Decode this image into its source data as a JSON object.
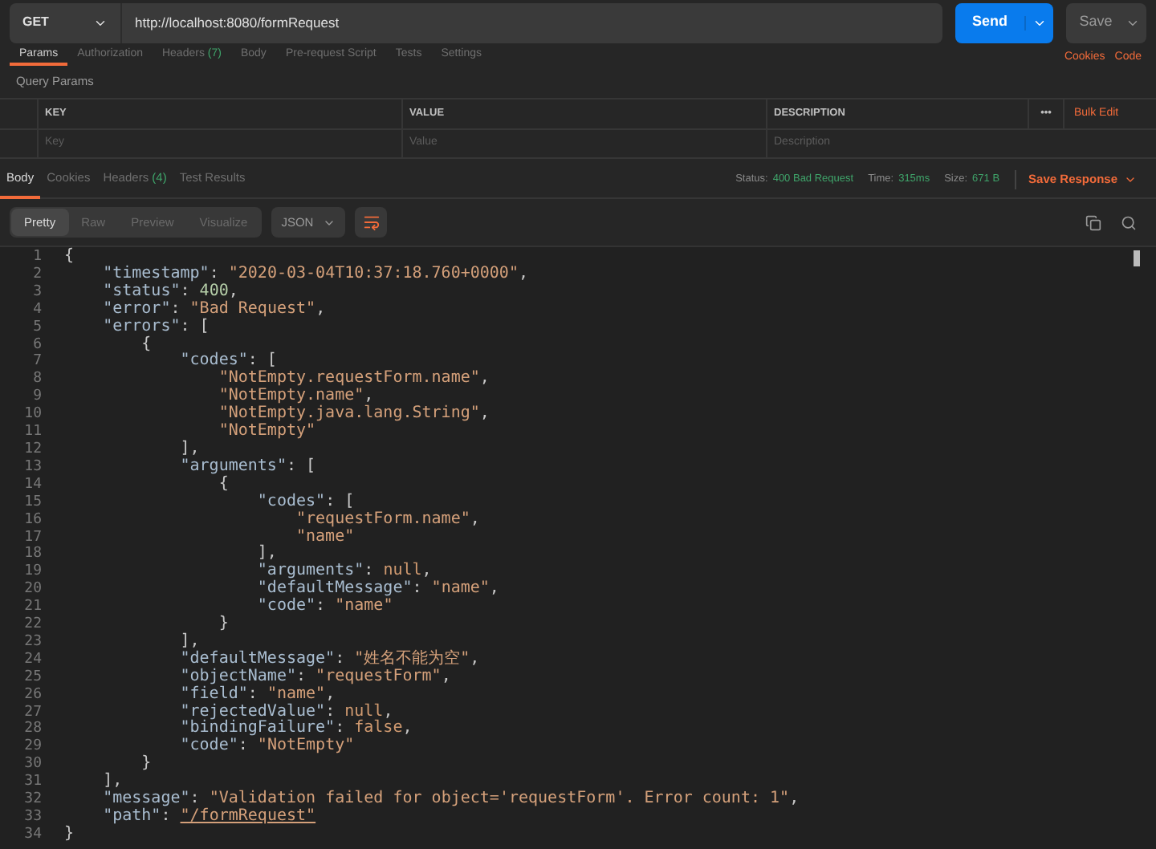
{
  "request": {
    "method": "GET",
    "url": "http://localhost:8080/formRequest",
    "send": "Send",
    "save": "Save"
  },
  "request_tabs": [
    {
      "label": "Params",
      "selected": true
    },
    {
      "label": "Authorization",
      "selected": false
    },
    {
      "label": "Headers",
      "count": "(7)",
      "selected": false
    },
    {
      "label": "Body",
      "selected": false
    },
    {
      "label": "Pre-request Script",
      "selected": false
    },
    {
      "label": "Tests",
      "selected": false
    },
    {
      "label": "Settings",
      "selected": false
    }
  ],
  "request_links": [
    "Cookies",
    "Code"
  ],
  "query_params": {
    "title": "Query Params",
    "columns": [
      "KEY",
      "VALUE",
      "DESCRIPTION"
    ],
    "more": "•••",
    "bulk_edit": "Bulk Edit",
    "placeholders": [
      "Key",
      "Value",
      "Description"
    ]
  },
  "response_tabs": [
    {
      "label": "Body",
      "selected": true
    },
    {
      "label": "Cookies",
      "selected": false
    },
    {
      "label": "Headers",
      "count": "(4)",
      "selected": false
    },
    {
      "label": "Test Results",
      "selected": false
    }
  ],
  "response_meta": [
    {
      "label": "Status:",
      "value": "400 Bad Request"
    },
    {
      "label": "Time:",
      "value": "315ms"
    },
    {
      "label": "Size:",
      "value": "671 B"
    }
  ],
  "save_response": "Save Response",
  "view_modes": [
    {
      "label": "Pretty",
      "selected": true
    },
    {
      "label": "Raw",
      "selected": false
    },
    {
      "label": "Preview",
      "selected": false
    },
    {
      "label": "Visualize",
      "selected": false
    }
  ],
  "format": "JSON",
  "wrap_on": true,
  "code_lines": [
    {
      "number": "1",
      "tokens": [
        {
          "kind": "punct",
          "text": "{"
        }
      ]
    },
    {
      "number": "2",
      "tokens": [
        {
          "kind": "key",
          "text": "    \"timestamp\""
        },
        {
          "kind": "punct",
          "text": ": "
        },
        {
          "kind": "string",
          "text": "\"2020-03-04T10:37:18.760+0000\""
        },
        {
          "kind": "punct",
          "text": ","
        }
      ]
    },
    {
      "number": "3",
      "tokens": [
        {
          "kind": "key",
          "text": "    \"status\""
        },
        {
          "kind": "punct",
          "text": ": "
        },
        {
          "kind": "number",
          "text": "400"
        },
        {
          "kind": "punct",
          "text": ","
        }
      ]
    },
    {
      "number": "4",
      "tokens": [
        {
          "kind": "key",
          "text": "    \"error\""
        },
        {
          "kind": "punct",
          "text": ": "
        },
        {
          "kind": "string",
          "text": "\"Bad Request\""
        },
        {
          "kind": "punct",
          "text": ","
        }
      ]
    },
    {
      "number": "5",
      "tokens": [
        {
          "kind": "key",
          "text": "    \"errors\""
        },
        {
          "kind": "punct",
          "text": ": ["
        }
      ]
    },
    {
      "number": "6",
      "tokens": [
        {
          "kind": "punct",
          "text": "        {"
        }
      ]
    },
    {
      "number": "7",
      "tokens": [
        {
          "kind": "key",
          "text": "            \"codes\""
        },
        {
          "kind": "punct",
          "text": ": ["
        }
      ]
    },
    {
      "number": "8",
      "tokens": [
        {
          "kind": "string",
          "text": "                \"NotEmpty.requestForm.name\""
        },
        {
          "kind": "punct",
          "text": ","
        }
      ]
    },
    {
      "number": "9",
      "tokens": [
        {
          "kind": "string",
          "text": "                \"NotEmpty.name\""
        },
        {
          "kind": "punct",
          "text": ","
        }
      ]
    },
    {
      "number": "10",
      "tokens": [
        {
          "kind": "string",
          "text": "                \"NotEmpty.java.lang.String\""
        },
        {
          "kind": "punct",
          "text": ","
        }
      ]
    },
    {
      "number": "11",
      "tokens": [
        {
          "kind": "string",
          "text": "                \"NotEmpty\""
        }
      ]
    },
    {
      "number": "12",
      "tokens": [
        {
          "kind": "punct",
          "text": "            ],"
        }
      ]
    },
    {
      "number": "13",
      "tokens": [
        {
          "kind": "key",
          "text": "            \"arguments\""
        },
        {
          "kind": "punct",
          "text": ": ["
        }
      ]
    },
    {
      "number": "14",
      "tokens": [
        {
          "kind": "punct",
          "text": "                {"
        }
      ]
    },
    {
      "number": "15",
      "tokens": [
        {
          "kind": "key",
          "text": "                    \"codes\""
        },
        {
          "kind": "punct",
          "text": ": ["
        }
      ]
    },
    {
      "number": "16",
      "tokens": [
        {
          "kind": "string",
          "text": "                        \"requestForm.name\""
        },
        {
          "kind": "punct",
          "text": ","
        }
      ]
    },
    {
      "number": "17",
      "tokens": [
        {
          "kind": "string",
          "text": "                        \"name\""
        }
      ]
    },
    {
      "number": "18",
      "tokens": [
        {
          "kind": "punct",
          "text": "                    ],"
        }
      ]
    },
    {
      "number": "19",
      "tokens": [
        {
          "kind": "key",
          "text": "                    \"arguments\""
        },
        {
          "kind": "punct",
          "text": ": "
        },
        {
          "kind": "literal",
          "text": "null"
        },
        {
          "kind": "punct",
          "text": ","
        }
      ]
    },
    {
      "number": "20",
      "tokens": [
        {
          "kind": "key",
          "text": "                    \"defaultMessage\""
        },
        {
          "kind": "punct",
          "text": ": "
        },
        {
          "kind": "string",
          "text": "\"name\""
        },
        {
          "kind": "punct",
          "text": ","
        }
      ]
    },
    {
      "number": "21",
      "tokens": [
        {
          "kind": "key",
          "text": "                    \"code\""
        },
        {
          "kind": "punct",
          "text": ": "
        },
        {
          "kind": "string",
          "text": "\"name\""
        }
      ]
    },
    {
      "number": "22",
      "tokens": [
        {
          "kind": "punct",
          "text": "                }"
        }
      ]
    },
    {
      "number": "23",
      "tokens": [
        {
          "kind": "punct",
          "text": "            ],"
        }
      ]
    },
    {
      "number": "24",
      "tokens": [
        {
          "kind": "key",
          "text": "            \"defaultMessage\""
        },
        {
          "kind": "punct",
          "text": ": "
        },
        {
          "kind": "string",
          "text": "\"姓名不能为空\""
        },
        {
          "kind": "punct",
          "text": ","
        }
      ]
    },
    {
      "number": "25",
      "tokens": [
        {
          "kind": "key",
          "text": "            \"objectName\""
        },
        {
          "kind": "punct",
          "text": ": "
        },
        {
          "kind": "string",
          "text": "\"requestForm\""
        },
        {
          "kind": "punct",
          "text": ","
        }
      ]
    },
    {
      "number": "26",
      "tokens": [
        {
          "kind": "key",
          "text": "            \"field\""
        },
        {
          "kind": "punct",
          "text": ": "
        },
        {
          "kind": "string",
          "text": "\"name\""
        },
        {
          "kind": "punct",
          "text": ","
        }
      ]
    },
    {
      "number": "27",
      "tokens": [
        {
          "kind": "key",
          "text": "            \"rejectedValue\""
        },
        {
          "kind": "punct",
          "text": ": "
        },
        {
          "kind": "literal",
          "text": "null"
        },
        {
          "kind": "punct",
          "text": ","
        }
      ]
    },
    {
      "number": "28",
      "tokens": [
        {
          "kind": "key",
          "text": "            \"bindingFailure\""
        },
        {
          "kind": "punct",
          "text": ": "
        },
        {
          "kind": "literal",
          "text": "false"
        },
        {
          "kind": "punct",
          "text": ","
        }
      ]
    },
    {
      "number": "29",
      "tokens": [
        {
          "kind": "key",
          "text": "            \"code\""
        },
        {
          "kind": "punct",
          "text": ": "
        },
        {
          "kind": "string",
          "text": "\"NotEmpty\""
        }
      ]
    },
    {
      "number": "30",
      "tokens": [
        {
          "kind": "punct",
          "text": "        }"
        }
      ]
    },
    {
      "number": "31",
      "tokens": [
        {
          "kind": "punct",
          "text": "    ],"
        }
      ]
    },
    {
      "number": "32",
      "tokens": [
        {
          "kind": "key",
          "text": "    \"message\""
        },
        {
          "kind": "punct",
          "text": ": "
        },
        {
          "kind": "string",
          "text": "\"Validation failed for object='requestForm'. Error count: 1\""
        },
        {
          "kind": "punct",
          "text": ","
        }
      ]
    },
    {
      "number": "33",
      "tokens": [
        {
          "kind": "key",
          "text": "    \"path\""
        },
        {
          "kind": "punct",
          "text": ": "
        },
        {
          "kind": "link",
          "text": "\"/formRequest\""
        }
      ]
    },
    {
      "number": "34",
      "tokens": [
        {
          "kind": "punct",
          "text": "}"
        }
      ]
    }
  ]
}
